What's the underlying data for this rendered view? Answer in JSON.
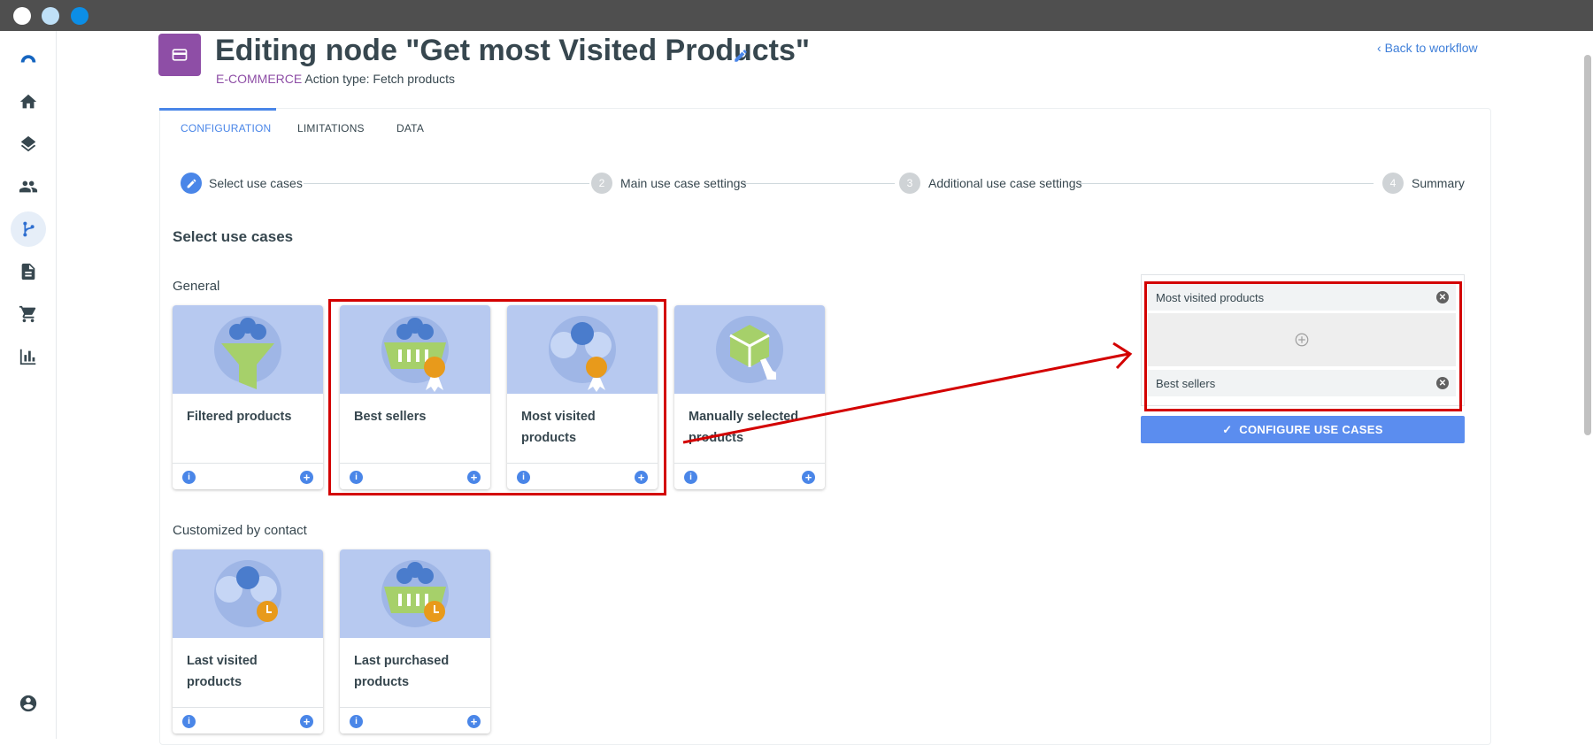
{
  "window": {
    "title_bar": ""
  },
  "sidebar": {
    "items": [
      {
        "icon": "logo-icon"
      },
      {
        "icon": "home-icon"
      },
      {
        "icon": "layers-icon"
      },
      {
        "icon": "people-icon"
      },
      {
        "icon": "workflow-icon",
        "active": true
      },
      {
        "icon": "document-icon"
      },
      {
        "icon": "cart-icon"
      },
      {
        "icon": "bar-chart-icon"
      },
      {
        "icon": "account-icon"
      }
    ]
  },
  "header": {
    "title": "Editing node \"Get most Visited Products\"",
    "category": "E-COMMERCE",
    "action_type": "Action type: Fetch products",
    "back_link": "Back to workflow",
    "accent_color": "#8e4ea6"
  },
  "tabs": [
    {
      "label": "CONFIGURATION",
      "active": true
    },
    {
      "label": "LIMITATIONS"
    },
    {
      "label": "DATA"
    }
  ],
  "steps": [
    {
      "number": "1",
      "label": "Select use cases",
      "active": true
    },
    {
      "number": "2",
      "label": "Main use case settings"
    },
    {
      "number": "3",
      "label": "Additional use case settings"
    },
    {
      "number": "4",
      "label": "Summary"
    }
  ],
  "section_title": "Select use cases",
  "groups": {
    "general": {
      "label": "General",
      "cards": [
        {
          "name": "Filtered products",
          "icon": "funnel-icon"
        },
        {
          "name": "Best sellers",
          "icon": "basket-medal-icon"
        },
        {
          "name": "Most visited products",
          "icon": "boxes-medal-icon"
        },
        {
          "name": "Manually selected products",
          "icon": "box-hand-icon"
        }
      ]
    },
    "contact": {
      "label": "Customized by contact",
      "cards": [
        {
          "name": "Last visited products",
          "icon": "boxes-clock-icon"
        },
        {
          "name": "Last purchased products",
          "icon": "basket-clock-icon"
        }
      ]
    }
  },
  "selected": {
    "items": [
      "Most visited products",
      "Best sellers"
    ],
    "configure_label": "CONFIGURE USE CASES"
  },
  "colors": {
    "primary": "#4a86e8",
    "card_image": "#b7c9f0",
    "highlight": "#d30000"
  }
}
